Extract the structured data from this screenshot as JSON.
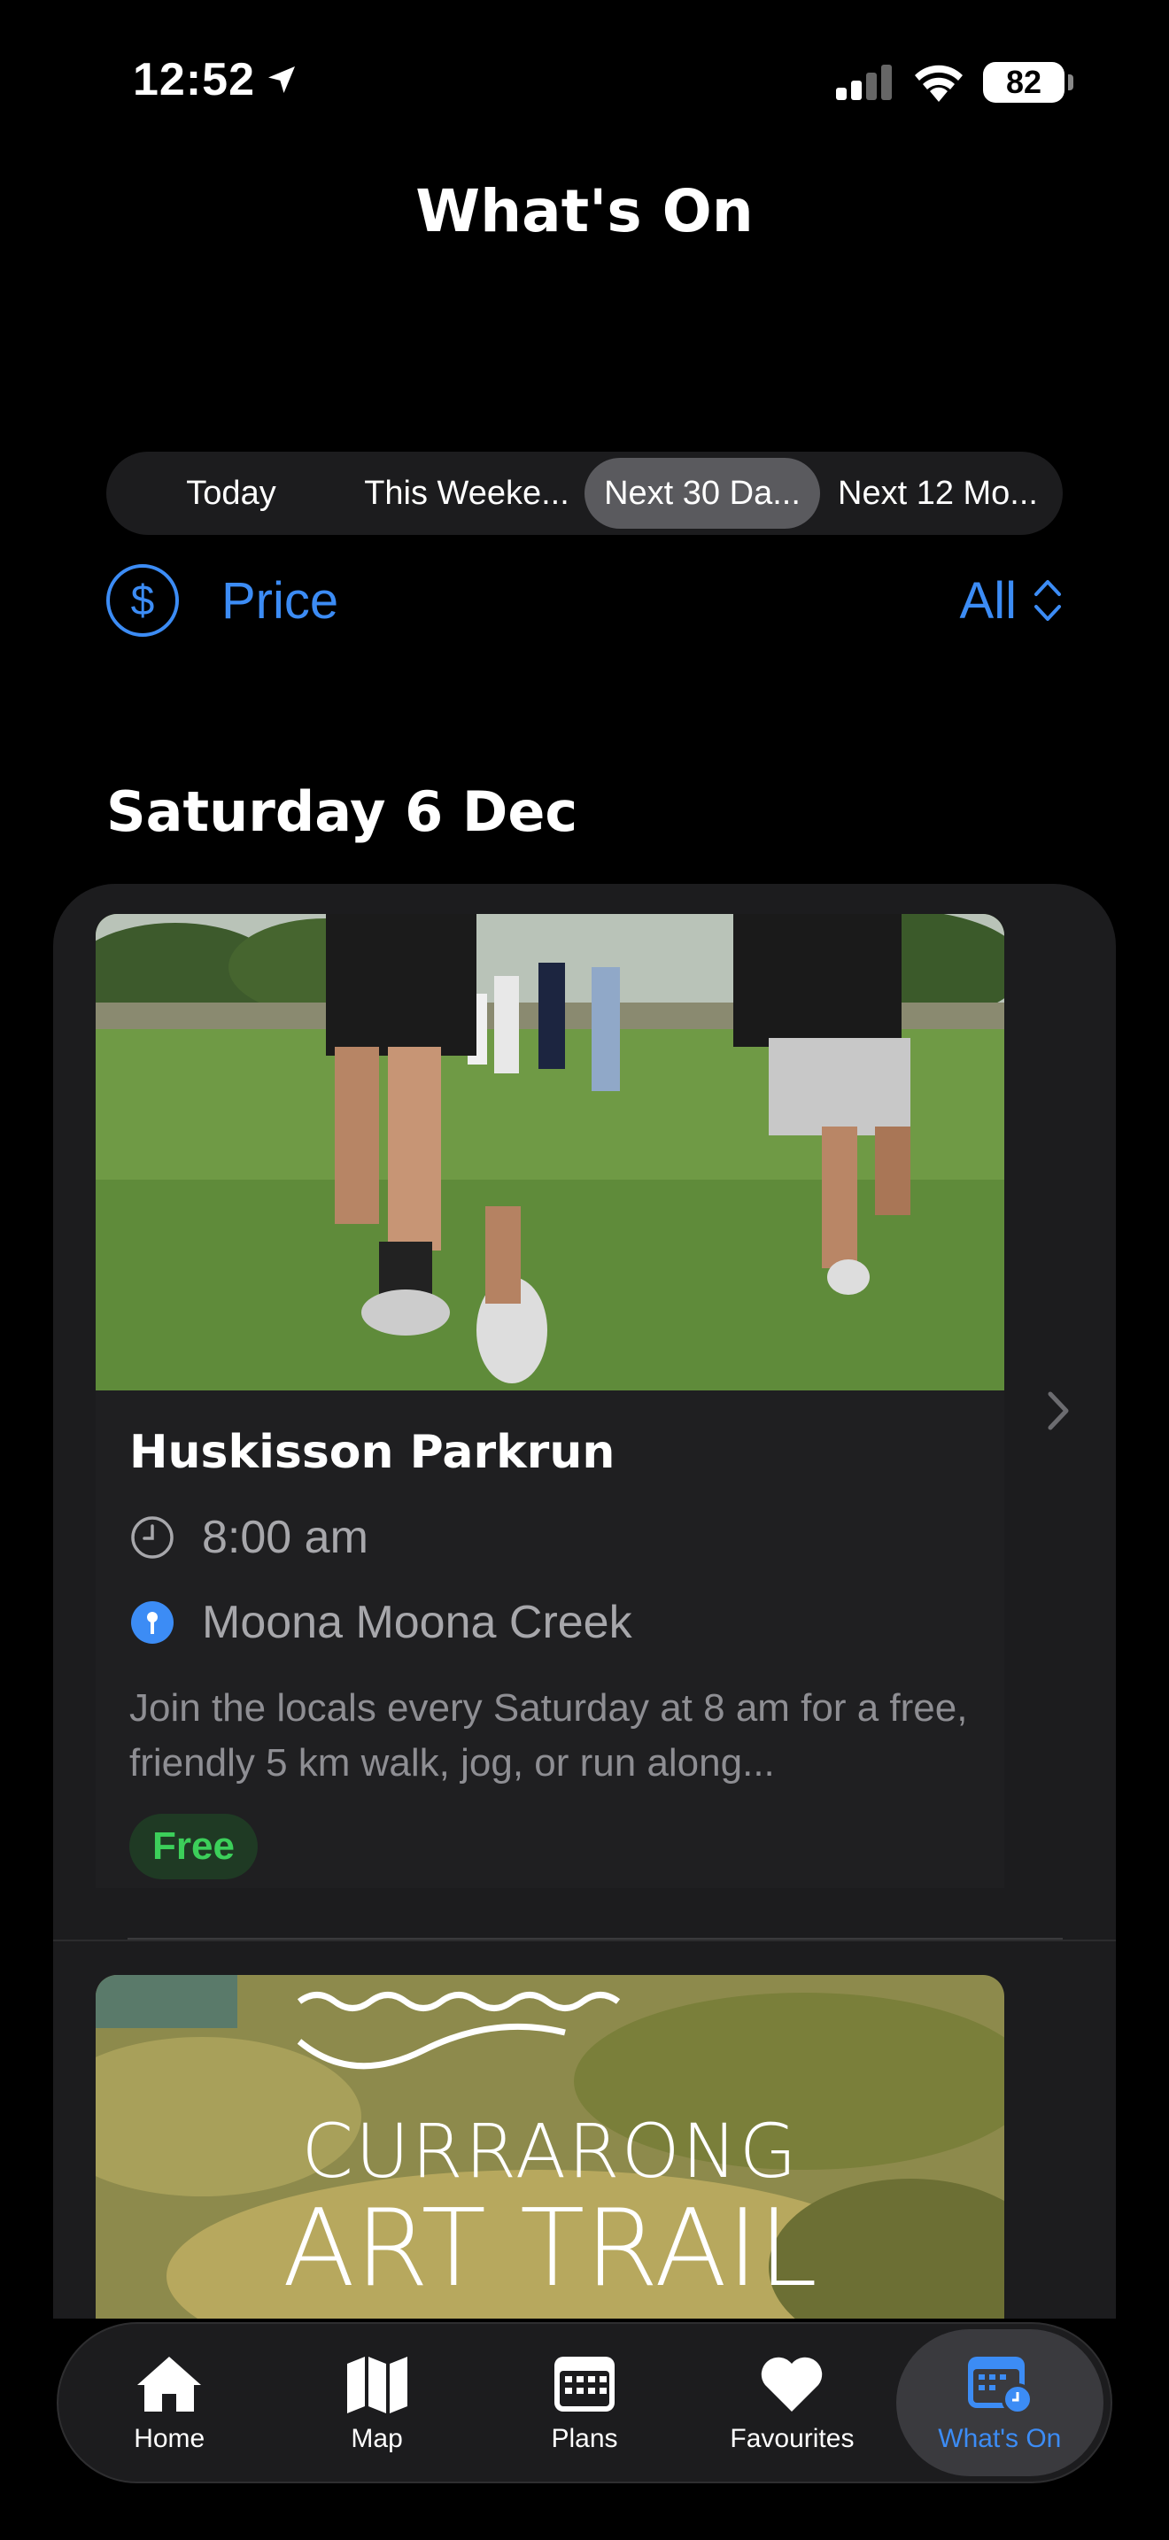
{
  "status_bar": {
    "time": "12:52",
    "battery": "82"
  },
  "header": {
    "title": "What's On"
  },
  "filter_tabs": [
    {
      "label": "Today",
      "active": false
    },
    {
      "label": "This Weeke...",
      "active": false
    },
    {
      "label": "Next 30 Da...",
      "active": true
    },
    {
      "label": "Next 12 Mo...",
      "active": false
    }
  ],
  "price_filter": {
    "label": "Price",
    "value": "All",
    "icon": "dollar-circle-icon"
  },
  "section": {
    "title": "Saturday 6 Dec"
  },
  "events": [
    {
      "title": "Huskisson Parkrun",
      "time": "8:00 am",
      "location": "Moona Moona Creek",
      "description": "Join the locals every Saturday at 8 am for a free, friendly 5 km walk, jog, or run along...",
      "price_badge": "Free"
    },
    {
      "image_text_line1": "CURRARONG",
      "image_text_line2": "ART TRAIL"
    }
  ],
  "tab_bar": [
    {
      "label": "Home",
      "icon": "home-icon",
      "active": false
    },
    {
      "label": "Map",
      "icon": "map-icon",
      "active": false
    },
    {
      "label": "Plans",
      "icon": "calendar-icon",
      "active": false
    },
    {
      "label": "Favourites",
      "icon": "heart-icon",
      "active": false
    },
    {
      "label": "What's On",
      "icon": "calendar-clock-icon",
      "active": true
    }
  ],
  "colors": {
    "accent": "#3c8cf5",
    "free_badge_text": "#3ccf5a",
    "free_badge_bg": "#1f3a24",
    "card_bg": "#1c1c1e"
  }
}
